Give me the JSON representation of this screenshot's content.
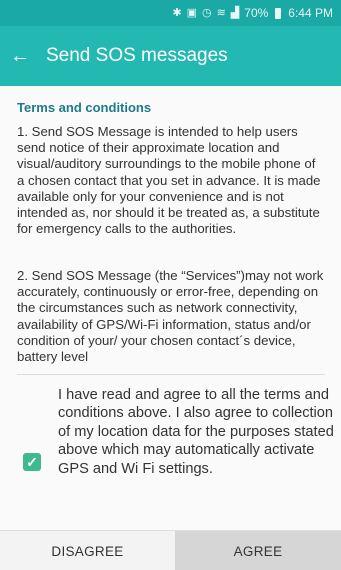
{
  "status_bar": {
    "icons": [
      "bluetooth-icon",
      "nfc-icon",
      "alarm-icon",
      "wifi-icon",
      "signal-icon"
    ],
    "battery": "70%",
    "time": "6:44 PM"
  },
  "app_bar": {
    "title": "Send SOS messages"
  },
  "terms": {
    "heading": "Terms and conditions",
    "paragraph_1": "1. Send SOS Message is intended to help users send notice of their approximate location and visual/auditory surroundings to the mobile phone of a chosen contact that you set in advance. It is made available only for your convenience and is not intended as, nor should it be treated as, a substitute for emergency calls to the authorities.",
    "paragraph_2": "2. Send SOS Message (the “Services”)may not work accurately, continuously or error-free, depending on the circumstances such as network connectivity, availability of GPS/Wi-Fi information, status and/or condition of your/ your chosen contact´s device, battery level"
  },
  "agreement": {
    "checked": true,
    "text": "I have read and agree to all the terms and conditions above. I also agree to collection of my location data for the purposes stated above which may automatically activate GPS and Wi Fi settings."
  },
  "buttons": {
    "disagree": "DISAGREE",
    "agree": "AGREE"
  },
  "colors": {
    "status_bar": "#1aa9a5",
    "app_bar": "#24b8b2",
    "heading": "#1f7a8c",
    "checkbox": "#3fb98f"
  }
}
